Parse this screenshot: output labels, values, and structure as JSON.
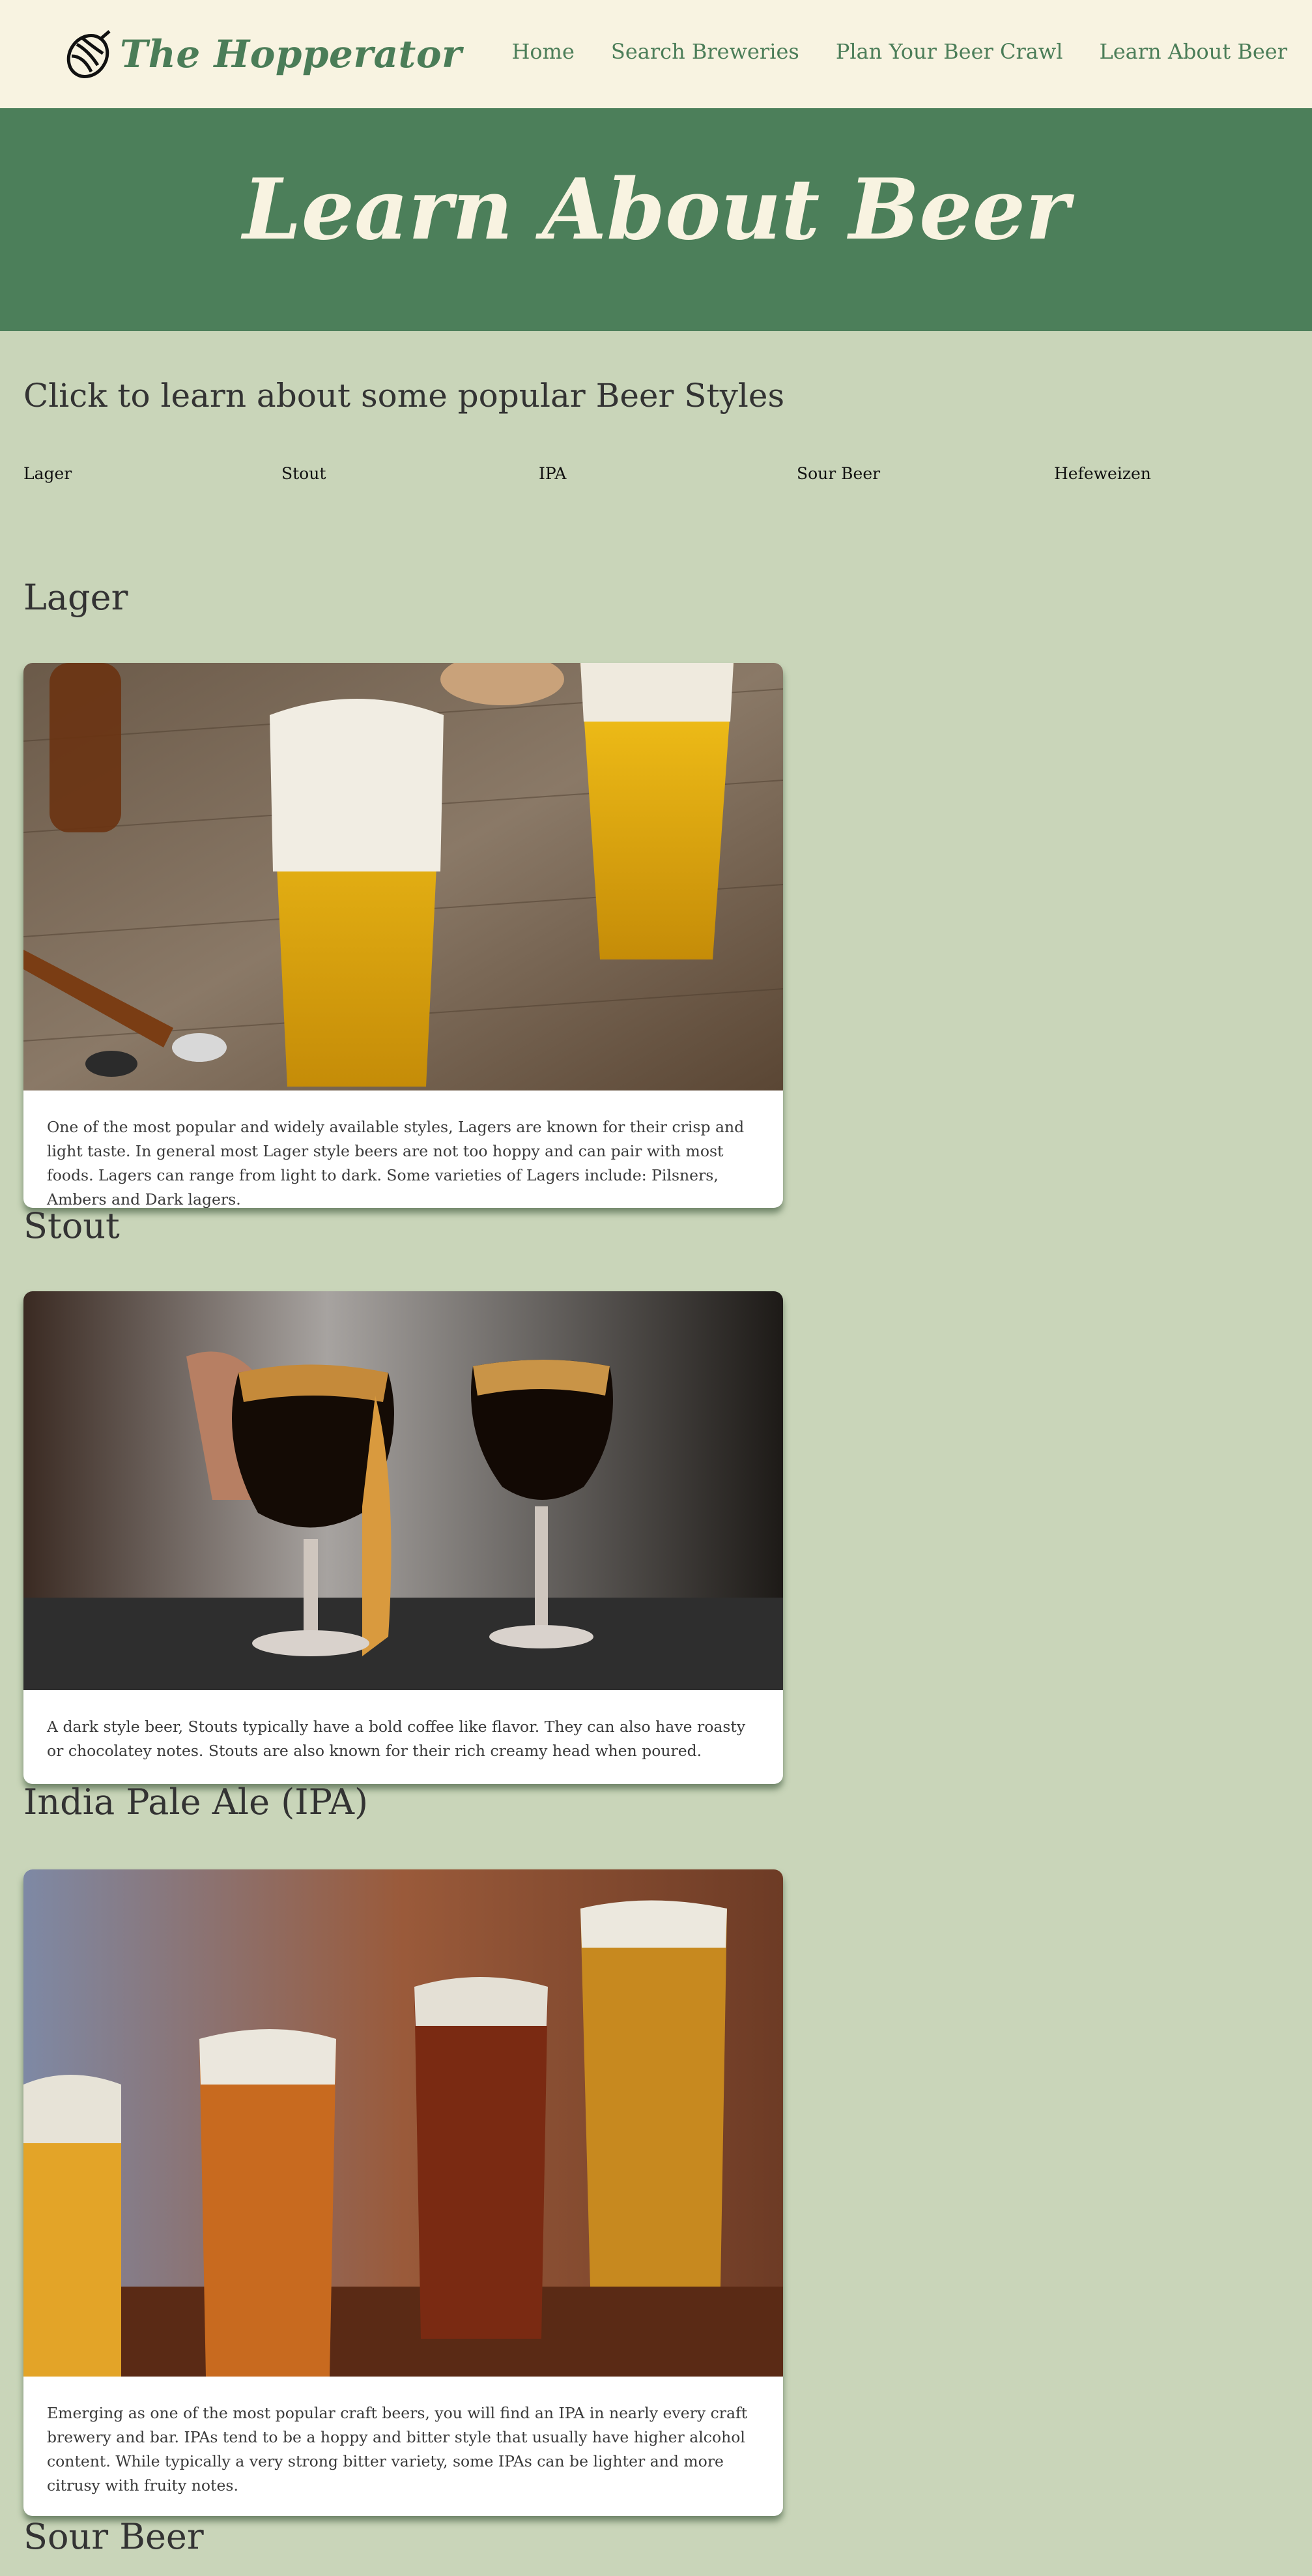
{
  "header": {
    "brand": "The Hopperator",
    "nav": [
      "Home",
      "Search Breweries",
      "Plan Your Beer Crawl",
      "Learn About Beer"
    ]
  },
  "hero": {
    "title": "Learn About Beer"
  },
  "styles_section": {
    "heading": "Click to learn about some popular Beer Styles",
    "links": [
      "Lager",
      "Stout",
      "IPA",
      "Sour Beer",
      "Hefeweizen"
    ]
  },
  "sections": [
    {
      "title": "Lager",
      "text": "One of the most popular and widely available styles, Lagers are known for their crisp and light taste. In general most Lager style beers are not too hoppy and can pair with most foods. Lagers can range from light to dark. Some varieties of Lagers include: Pilsners, Ambers and Dark lagers."
    },
    {
      "title": "Stout",
      "text": "A dark style beer, Stouts typically have a bold coffee like flavor. They can also have roasty or chocolatey notes. Stouts are also known for their rich creamy head when poured."
    },
    {
      "title": "India Pale Ale (IPA)",
      "text": "Emerging as one of the most popular craft beers, you will find an IPA in nearly every craft brewery and bar. IPAs tend to be a hoppy and bitter style that usually have higher alcohol content. While typically a very strong bitter variety, some IPAs can be lighter and more citrusy with fruity notes."
    },
    {
      "title": "Sour Beer"
    }
  ],
  "colors": {
    "header_bg": "#f8f3e1",
    "brand_green": "#4b7d58",
    "hero_bg": "#4c7f5a",
    "page_bg": "#c9d5b9"
  }
}
